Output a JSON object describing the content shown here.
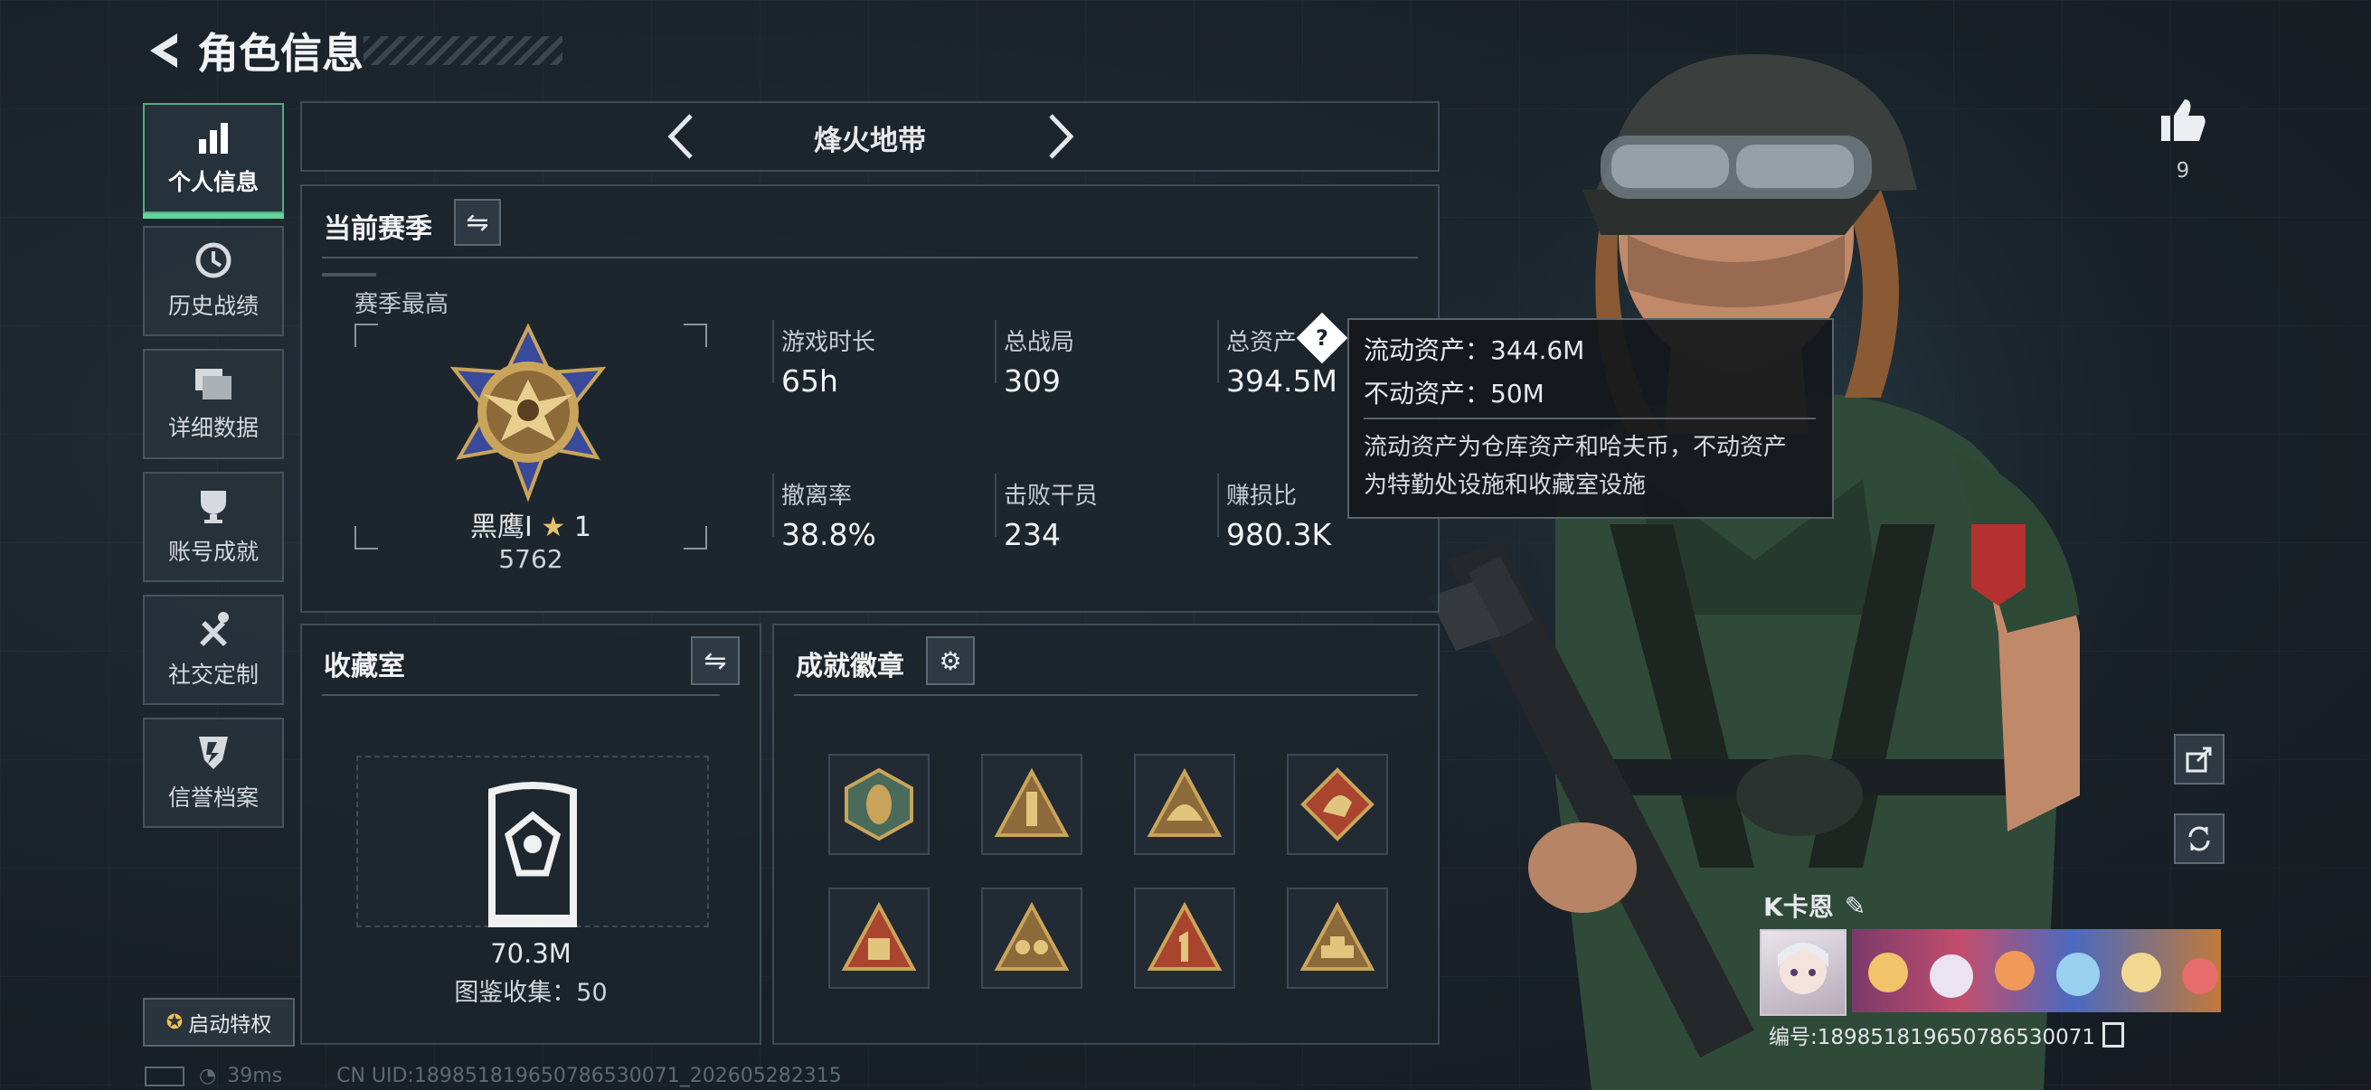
{
  "header": {
    "title": "角色信息"
  },
  "nav": {
    "items": [
      {
        "label": "个人信息",
        "icon": "bar-chart-icon",
        "active": true
      },
      {
        "label": "历史战绩",
        "icon": "history-icon",
        "active": false
      },
      {
        "label": "详细数据",
        "icon": "folder-icon",
        "active": false
      },
      {
        "label": "账号成就",
        "icon": "trophy-icon",
        "active": false
      },
      {
        "label": "社交定制",
        "icon": "tools-icon",
        "active": false
      },
      {
        "label": "信誉档案",
        "icon": "shield-icon",
        "active": false
      }
    ],
    "privilege_label": "启动特权"
  },
  "mode_selector": {
    "label": "烽火地带"
  },
  "season": {
    "title": "当前赛季",
    "best_label": "赛季最高",
    "rank_name": "黑鹰I",
    "rank_stars": "1",
    "rank_points": "5762",
    "stats": [
      {
        "label": "游戏时长",
        "value": "65h"
      },
      {
        "label": "总战局",
        "value": "309"
      },
      {
        "label": "总资产",
        "value": "394.5M"
      },
      {
        "label": "撤离率",
        "value": "38.8%"
      },
      {
        "label": "击败干员",
        "value": "234"
      },
      {
        "label": "赚损比",
        "value": "980.3K"
      }
    ]
  },
  "tooltip": {
    "line1": "流动资产：344.6M",
    "line2": "不动资产：50M",
    "desc1": "流动资产为仓库资产和哈夫币，不动资产",
    "desc2": "为特勤处设施和收藏室设施"
  },
  "collection": {
    "title": "收藏室",
    "value": "70.3M",
    "catalog": "图鉴收集：50"
  },
  "achievements": {
    "title": "成就徽章",
    "badges": [
      "wasp-badge",
      "rocket-badge",
      "helmet-badge",
      "dragon-badge",
      "fuel-badge",
      "squad-badge",
      "number-one-badge",
      "tank-badge"
    ],
    "colors": {
      "gold": "#c9a45a",
      "red": "#a9452e",
      "bronze": "#8c6a3a"
    }
  },
  "character": {
    "likes": "9",
    "player_name": "K卡恩",
    "player_id": "编号:189851819650786530071"
  },
  "status_bar": {
    "ping": "39ms",
    "uid": "CN UID:189851819650786530071_202605282315"
  }
}
